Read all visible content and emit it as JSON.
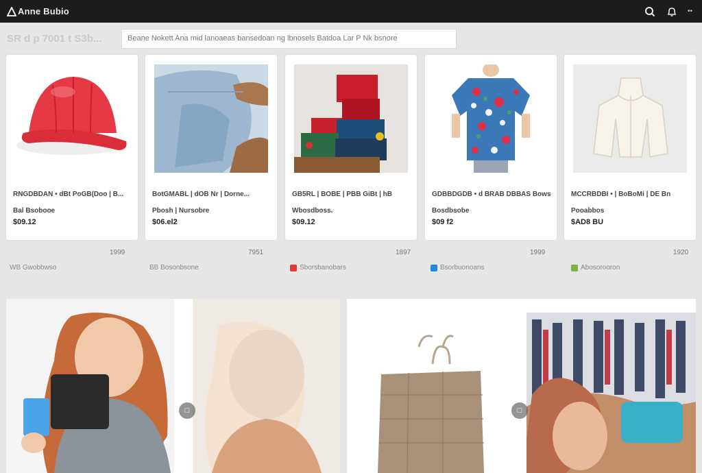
{
  "app": {
    "title": "Anne Bubio"
  },
  "header": {
    "icons": [
      "search-icon",
      "bell-icon",
      "more-icon"
    ],
    "more_glyph": "••"
  },
  "search": {
    "section_label": "SR d p 7001 t S3b...",
    "placeholder": "Beane Nokett Ana mid lanoaeas bansedoan ng lbnosels Batdoa Lar P Nk bsnore"
  },
  "products": [
    {
      "title": "RNGDBDAN • dBt PoGB(Doo | B... Bal Bsobooe",
      "price": "$09.12",
      "count": "1999",
      "seller": "WB Gwobbwso",
      "badge_color": "",
      "image": "red-cap"
    },
    {
      "title": "BotGMABL | dOB Nr | Dorne... Pbosh | Nursobre",
      "price": "$06.el2",
      "count": "7951",
      "seller": "BB Bosonbsone",
      "badge_color": "",
      "image": "denim-jacket"
    },
    {
      "title": "GB5RL | BOBE | PBB GiBt | hB Wbosdboss.",
      "price": "$09.12",
      "count": "1897",
      "seller": "Sborsbanobars",
      "badge_color": "#e53935",
      "image": "gift-stack"
    },
    {
      "title": "GDBBDGDB • d BRAB DBBAS Bows Bosdbsobe",
      "price": "$09 f2",
      "count": "1999",
      "seller": "Bsorbuonoans",
      "badge_color": "#1e88e5",
      "image": "floral-shirt"
    },
    {
      "title": "MCCRBDBI • | BoBoMi | DE Bn Pooabbos",
      "price": "$AD8 BU",
      "count": "1920",
      "seller": "Abosorooron",
      "badge_color": "#7cb342",
      "image": "white-garment"
    }
  ],
  "banners": [
    {
      "name": "banner-left",
      "nav": "□"
    },
    {
      "name": "banner-right",
      "nav": "□"
    }
  ]
}
